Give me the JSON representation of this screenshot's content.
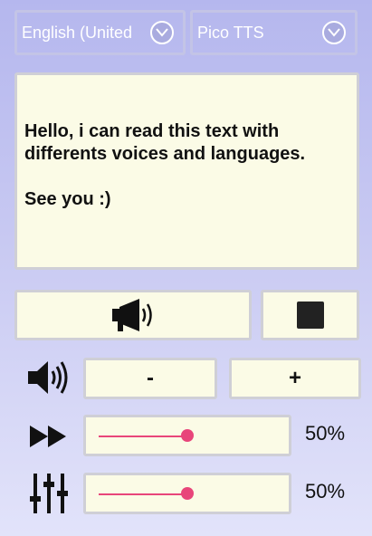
{
  "language_select": {
    "value": "English (United"
  },
  "engine_select": {
    "value": "Pico TTS"
  },
  "text_area": {
    "line1": "Hello, i can read this text with differents voices and languages.",
    "line2": "See you :)"
  },
  "volume": {
    "minus_label": "-",
    "plus_label": "+"
  },
  "speed": {
    "percent_label": "50%",
    "value": 0.5
  },
  "pitch": {
    "percent_label": "50%",
    "value": 0.5
  },
  "colors": {
    "accent": "#e8457a",
    "panel": "#fbfbe6",
    "background": "#b5b7ee"
  },
  "icons": {
    "speak": "megaphone-icon",
    "stop": "stop-icon",
    "volume": "speaker-icon",
    "speed": "fast-forward-icon",
    "pitch": "equalizer-icon"
  }
}
